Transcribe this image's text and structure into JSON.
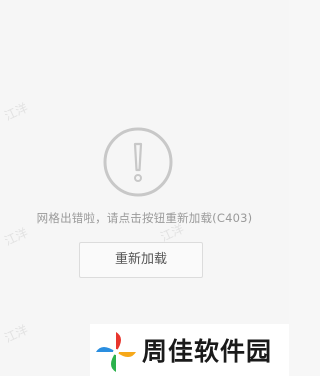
{
  "error": {
    "icon": "exclamation-circle-icon",
    "message": "网格出错啦，请点击按钮重新加载(C403)",
    "retry_label": "重新加载"
  },
  "watermark": {
    "text": "江洋"
  },
  "brand": {
    "logo": "pinwheel-logo",
    "name": "周佳软件园"
  },
  "colors": {
    "background": "#f6f6f6",
    "icon_stroke": "#c8c8c8",
    "message_text": "#9a9a9a",
    "button_border": "#dcdcdc"
  }
}
